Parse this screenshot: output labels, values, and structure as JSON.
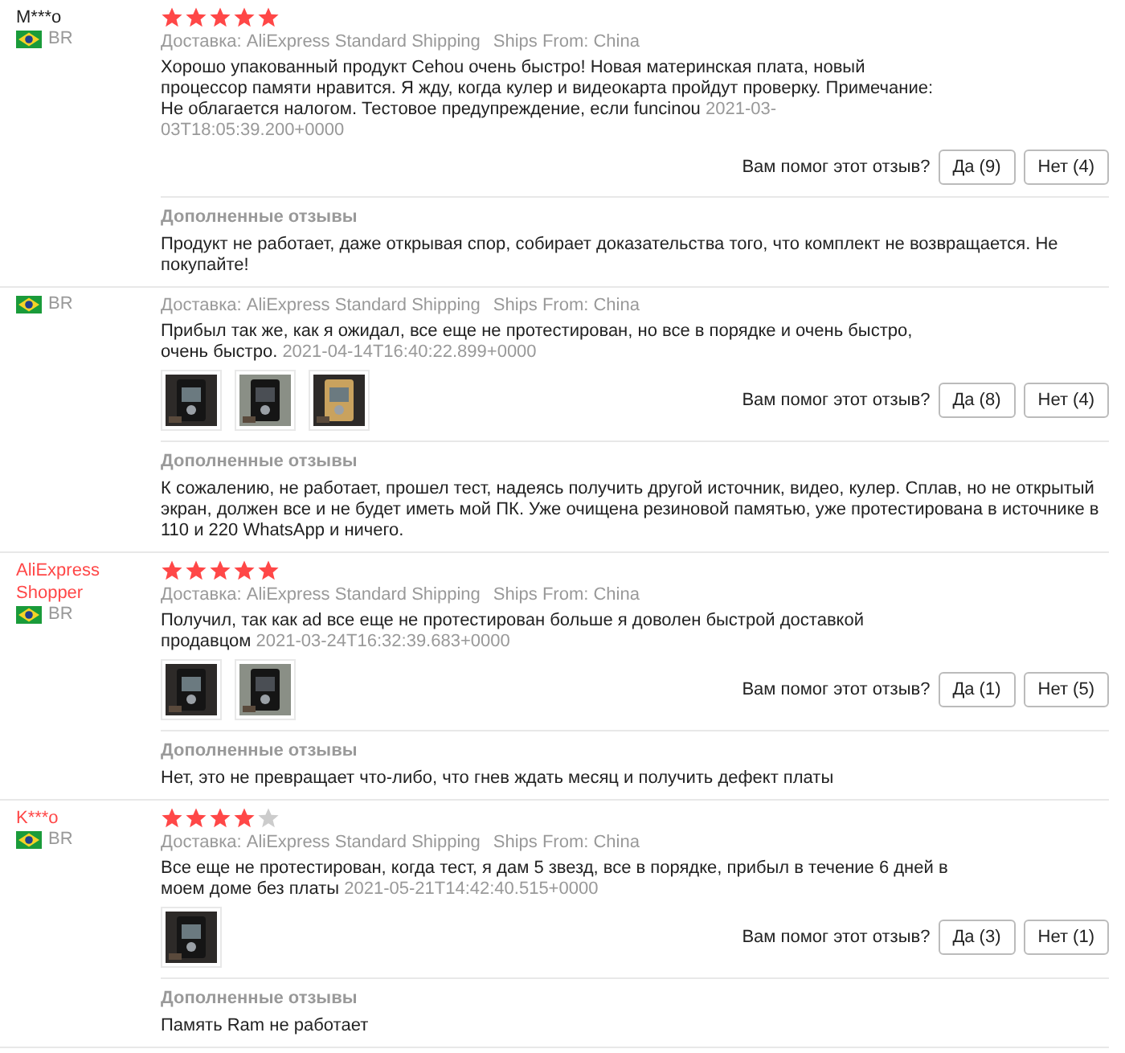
{
  "reviews": [
    {
      "name": "M***o",
      "color": "#222222",
      "country": "BR",
      "stars": 5,
      "shipping": "Доставка: AliExpress Standard Shipping",
      "ships_from": "Ships From: China",
      "text": "Хорошо упакованный продукт Cehou очень быстро! Новая материнская плата, новый процессор памяти нравится. Я жду, когда кулер и видеокарта пройдут проверку. Примечание: Не облагается налогом. Тестовое предупреждение, если funcinou",
      "date": "2021-03-03T18:05:39.200+0000",
      "helpful": "Вам помог этот отзыв?",
      "yes": "Да (9)",
      "no": "Нет (4)",
      "additional_title": "Дополненные отзывы",
      "additional_text": "Продукт не работает, даже открывая спор, собирает доказательства того, что комплект не возвращается. Не покупайте!"
    },
    {
      "country": "BR",
      "shipping": "Доставка: AliExpress Standard Shipping",
      "ships_from": "Ships From: China",
      "text": "Прибыл так же, как я ожидал, все еще не протестирован, но все в порядке и очень быстро, очень быстро.",
      "date": "2021-04-14T16:40:22.899+0000",
      "photos": [
        {
          "kind": "picture"
        },
        {
          "kind": "picture"
        },
        {
          "kind": "picture"
        }
      ],
      "helpful": "Вам помог этот отзыв?",
      "yes": "Да (8)",
      "no": "Нет (4)",
      "additional_title": "Дополненные отзывы",
      "additional_text": "К сожалению, не работает, прошел тест, надеясь получить другой источник, видео, кулер. Сплав, но не открытый экран, должен все и не будет иметь мой ПК. Уже очищена резиновой памятью, уже протестирована в источнике в 110 и 220 WhatsApp и ничего."
    },
    {
      "name": "AliExpress Shopper",
      "color": "#ff4747",
      "country": "BR",
      "stars": 5,
      "shipping": "Доставка: AliExpress Standard Shipping",
      "ships_from": "Ships From: China",
      "text": "Получил, так как ad все еще не протестирован больше я доволен быстрой доставкой продавцом",
      "date": "2021-03-24T16:32:39.683+0000",
      "photos": [
        {
          "kind": "picture"
        },
        {
          "kind": "picture"
        }
      ],
      "helpful": "Вам помог этот отзыв?",
      "yes": "Да (1)",
      "no": "Нет (5)",
      "additional_title": "Дополненные отзывы",
      "additional_text": "Нет, это не превращает что-либо, что гнев ждать месяц и получить дефект платы"
    },
    {
      "name": "K***o",
      "color": "#ff4747",
      "country": "BR",
      "stars": 4,
      "shipping": "Доставка: AliExpress Standard Shipping",
      "ships_from": "Ships From: China",
      "text": "Все еще не протестирован, когда тест, я дам 5 звезд, все в порядке, прибыл в течение 6 дней в моем доме без платы",
      "date": "2021-05-21T14:42:40.515+0000",
      "photos": [
        {
          "kind": "picture"
        }
      ],
      "helpful": "Вам помог этот отзыв?",
      "yes": "Да (3)",
      "no": "Нет (1)",
      "additional_title": "Дополненные отзывы",
      "additional_text": "Память Ram не работает"
    }
  ]
}
